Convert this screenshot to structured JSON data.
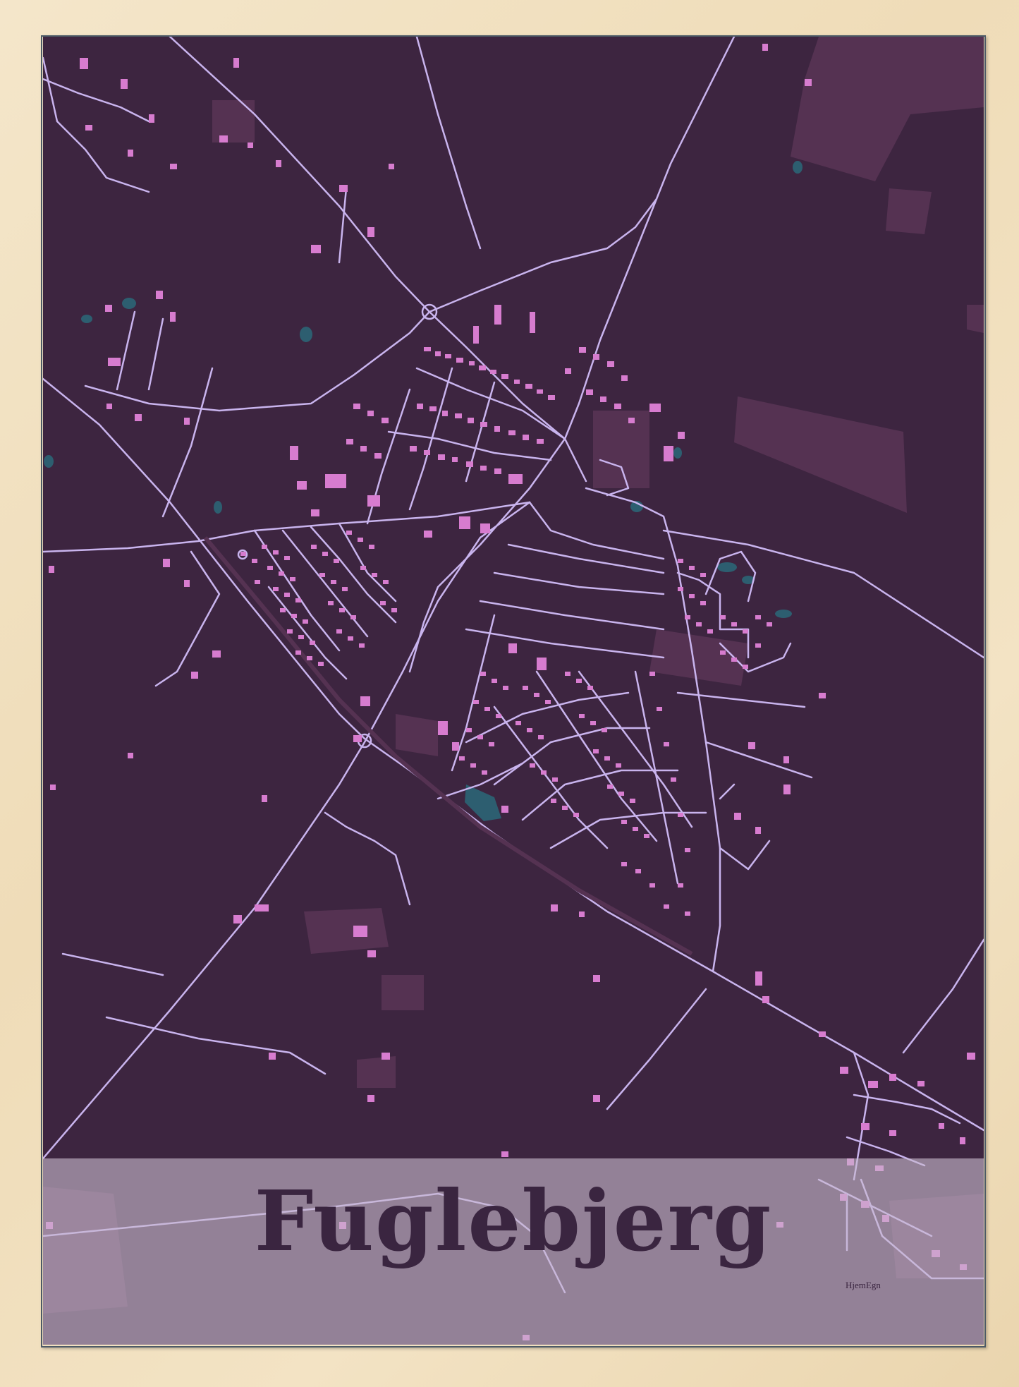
{
  "poster": {
    "city_name": "Fuglebjerg",
    "brand": "HjemEgn"
  },
  "colors": {
    "frame": "#f2e4c8",
    "background": "#3d2540",
    "fields": "#553252",
    "roads": "#c9b4ee",
    "buildings": "#d77ccf",
    "water": "#2d5e70",
    "caption_band": "#c8b9cd",
    "text": "#3a2540"
  }
}
